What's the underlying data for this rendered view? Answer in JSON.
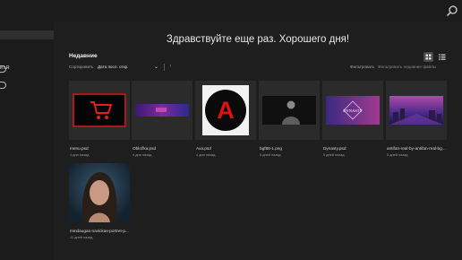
{
  "app": {
    "search_icon": "search-icon"
  },
  "sidebar": {
    "truncated_item": "и LR"
  },
  "main": {
    "greeting": "Здравствуйте еще раз. Хорошего дня!",
    "section_title": "Недавние",
    "sort_label": "Сортировать",
    "sort_value": "Дата посл. откр.",
    "sort_direction": "↑",
    "filter_label": "Фильтровать",
    "filter_placeholder": "Фильтровать недавние файлы"
  },
  "files": [
    {
      "name": "menu.psd",
      "date": "4 дня назад"
    },
    {
      "name": "Obložka.psd",
      "date": "4 дня назад"
    },
    {
      "name": "Ava.psd",
      "date": "4 дня назад"
    },
    {
      "name": "bgf88-1.png",
      "date": "5 дней назад"
    },
    {
      "name": "Dynasty.psd",
      "date": "5 дней назад"
    },
    {
      "name": "antifan-real-by-antifan-real-bg...",
      "date": "5 дней назад"
    },
    {
      "name": "mindaugas-navickas-portret-p...",
      "date": "11 дней назад"
    }
  ],
  "thumb_text": {
    "ava_letter": "A",
    "dynasty": "DYNASTY"
  },
  "colors": {
    "background": "#1e1e1e",
    "sidebar": "#1b1b1b",
    "card": "#2b2b2b",
    "accent_red": "#e02020"
  }
}
